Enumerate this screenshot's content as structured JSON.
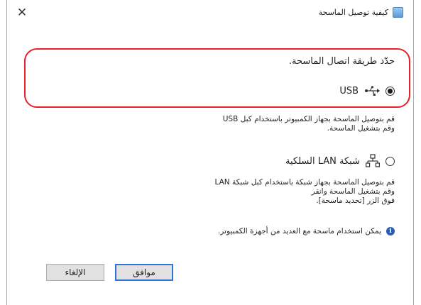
{
  "window": {
    "title": "كيفية توصيل الماسحة",
    "close_glyph": "✕"
  },
  "heading": "حدّد طريقة اتصال الماسحة.",
  "options": [
    {
      "label": "USB",
      "selected": true,
      "icon": "usb-icon",
      "description": [
        "قم بتوصيل الماسحة بجهاز الكمبيوتر باستخدام كبل USB",
        "وقم بتشغيل الماسحة."
      ]
    },
    {
      "label": "شبكة LAN السلكية",
      "selected": false,
      "icon": "network-icon",
      "description": [
        "قم بتوصيل الماسحة بجهاز شبكة باستخدام كبل شبكة LAN",
        "وقم بتشغيل الماسحة وانقر",
        "فوق الزر [تحديد ماسحة]."
      ]
    }
  ],
  "info": {
    "icon": "info-icon",
    "text": "يمكن استخدام ماسحة مع العديد من أجهزة الكمبيوتر."
  },
  "buttons": {
    "ok_label": "موافق",
    "cancel_label": "الإلغاء"
  },
  "colors": {
    "highlight": "#e8202a",
    "default_button_border": "#2e75d9",
    "info_icon": "#2a5db0"
  }
}
